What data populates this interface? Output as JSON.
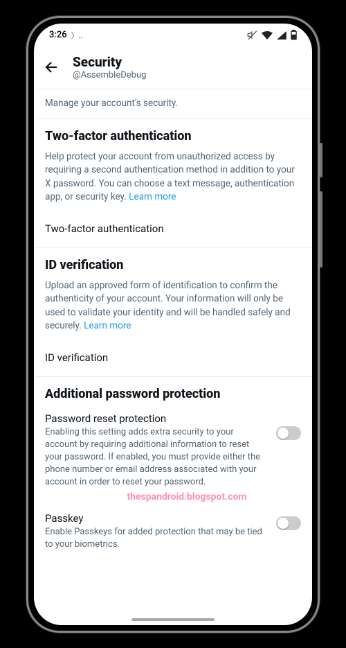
{
  "statusbar": {
    "time": "3:26",
    "extra": "〉.."
  },
  "header": {
    "title": "Security",
    "handle": "@AssembleDebug"
  },
  "subtitle": "Manage your account's security.",
  "twofa": {
    "heading": "Two-factor authentication",
    "body": "Help protect your account from unauthorized access by requiring a second authentication method in addition to your X password. You can choose a text message, authentication app, or security key.",
    "learn": "Learn more",
    "row": "Two-factor authentication"
  },
  "idv": {
    "heading": "ID verification",
    "body": "Upload an approved form of identification to confirm the authenticity of your account. Your information will only be used to validate your identity and will be handled safely and securely.",
    "learn": "Learn more",
    "row": "ID verification"
  },
  "app": {
    "heading": "Additional password protection",
    "prp_label": "Password reset protection",
    "prp_desc": "Enabling this setting adds extra security to your account by requiring additional information to reset your password. If enabled, you must provide either the phone number or email address associated with your account in order to reset your password.",
    "pk_label": "Passkey",
    "pk_desc": "Enable Passkeys for added protection that may be tied to your biometrics."
  },
  "watermark": "thespandroid.blogspot.com"
}
